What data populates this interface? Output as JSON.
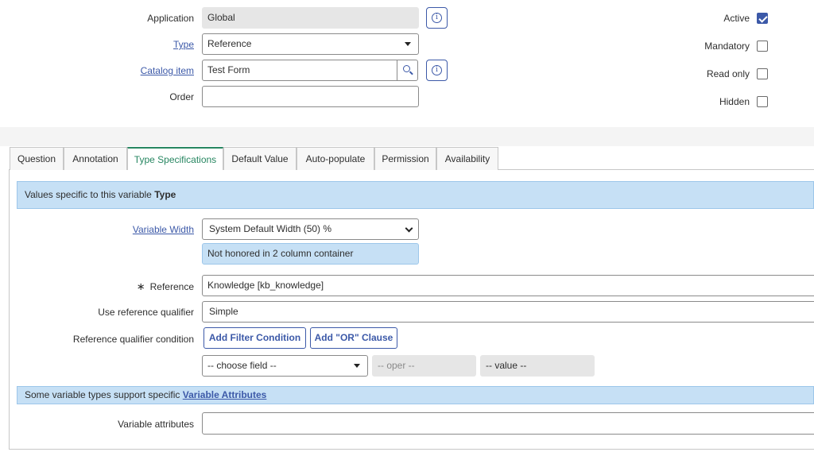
{
  "header": {
    "application": {
      "label": "Application",
      "value": "Global"
    },
    "type": {
      "label": "Type",
      "value": "Reference"
    },
    "catalog_item": {
      "label": "Catalog item",
      "value": "Test Form"
    },
    "order": {
      "label": "Order",
      "value": ""
    },
    "checkboxes": [
      {
        "label": "Active",
        "checked": true
      },
      {
        "label": "Mandatory",
        "checked": false
      },
      {
        "label": "Read only",
        "checked": false
      },
      {
        "label": "Hidden",
        "checked": false
      }
    ]
  },
  "tabs": [
    {
      "label": "Question",
      "active": false
    },
    {
      "label": "Annotation",
      "active": false
    },
    {
      "label": "Type Specifications",
      "active": true
    },
    {
      "label": "Default Value",
      "active": false
    },
    {
      "label": "Auto-populate",
      "active": false
    },
    {
      "label": "Permission",
      "active": false
    },
    {
      "label": "Availability",
      "active": false
    }
  ],
  "type_spec": {
    "banner_prefix": "Values specific to this variable ",
    "banner_bold": "Type",
    "variable_width": {
      "label": "Variable Width",
      "value": "System Default Width (50) %",
      "note": "Not honored in 2 column container"
    },
    "reference": {
      "required_mark": "∗",
      "label": "Reference",
      "value": "Knowledge [kb_knowledge]"
    },
    "use_ref_qualifier": {
      "label": "Use reference qualifier",
      "value": "Simple"
    },
    "ref_qualifier_condition": {
      "label": "Reference qualifier condition",
      "add_filter": "Add Filter Condition",
      "add_or": "Add \"OR\" Clause"
    },
    "filter": {
      "field": "-- choose field --",
      "oper": "-- oper --",
      "value": "-- value --"
    },
    "attr_banner_prefix": "Some variable types support specific ",
    "attr_banner_link": "Variable Attributes",
    "variable_attributes": {
      "label": "Variable attributes",
      "value": ""
    }
  },
  "colors": {
    "accent": "#3c59a8",
    "active_tab": "#278661",
    "banner": "#c6e0f5"
  }
}
